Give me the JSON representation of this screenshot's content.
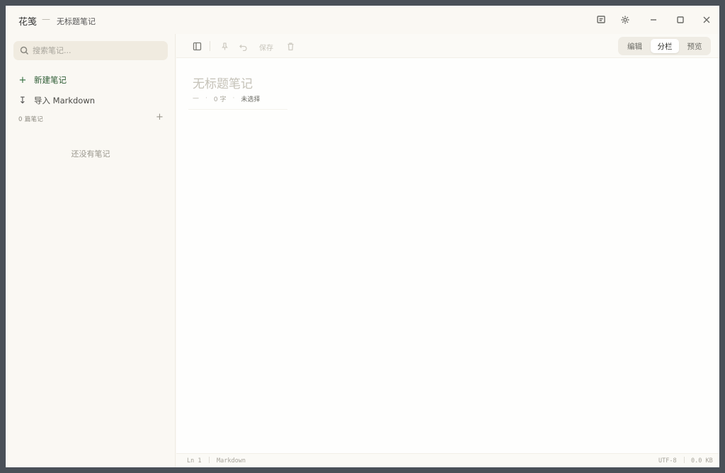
{
  "window": {
    "app_name": "花笺",
    "separator": "—",
    "doc_title": "无标题笔记"
  },
  "titlebar_icons": [
    "message-icon",
    "gear-icon",
    "minimize-icon",
    "maximize-icon",
    "close-icon"
  ],
  "sidebar": {
    "search_placeholder": "搜索笔记...",
    "new_note_label": "新建笔记",
    "import_label": "导入 Markdown",
    "notes_count": "0 篇笔记",
    "add_symbol": "+",
    "empty_message": "还没有笔记"
  },
  "toolbar": {
    "save_label": "保存",
    "view_modes": [
      "编辑",
      "分栏",
      "预览"
    ],
    "active_mode": "分栏"
  },
  "editor": {
    "title": "无标题笔记",
    "meta_dash": "—",
    "meta_dot": "·",
    "word_count": "0 字",
    "selection": "未选择"
  },
  "statusbar": {
    "line": "Ln 1",
    "language": "Markdown",
    "encoding": "UTF-8",
    "size": "0.0 KB",
    "divider": "|"
  },
  "colors": {
    "accent_green": "#2b5a32",
    "background": "#faf8f3",
    "frame": "#4a5058"
  }
}
